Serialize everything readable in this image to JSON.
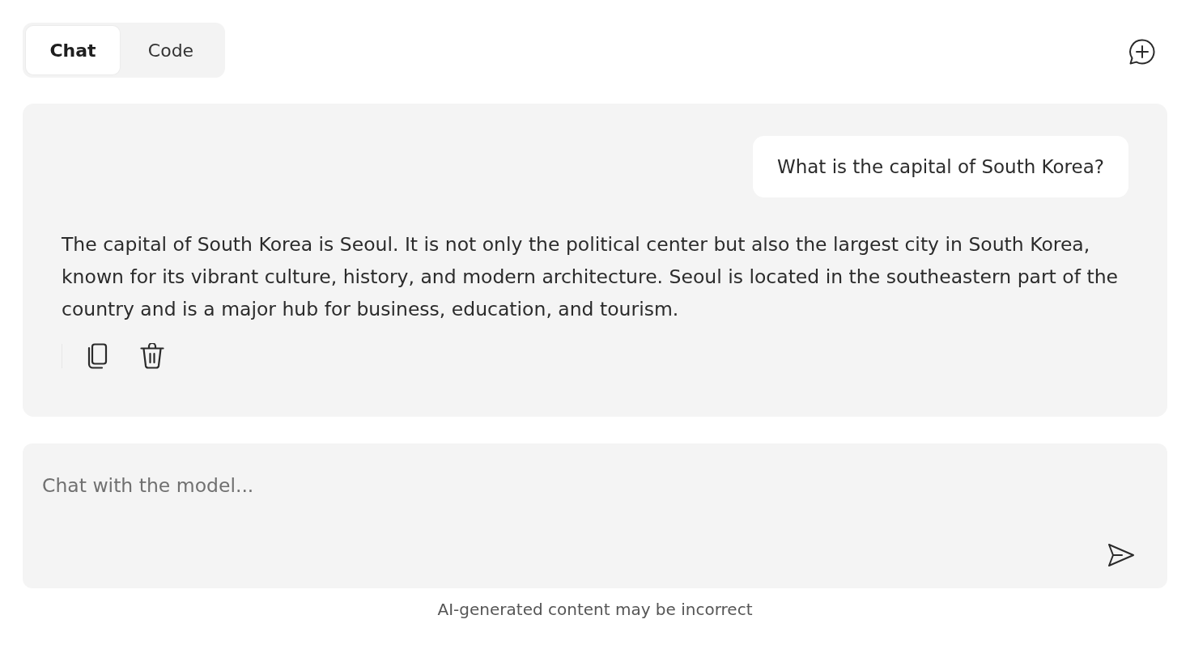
{
  "tabs": [
    {
      "label": "Chat",
      "selected": true
    },
    {
      "label": "Code",
      "selected": false
    }
  ],
  "conversation": {
    "messages": [
      {
        "kind": "user",
        "text": "What is the capital of South Korea?"
      },
      {
        "kind": "assistant",
        "text": "The capital of South Korea is Seoul. It is not only the political center but also the largest city in South Korea, known for its vibrant culture, history, and modern architecture. Seoul is located in the southeastern part of the country and is a major hub for business, education, and tourism."
      }
    ]
  },
  "composer": {
    "placeholder": "Chat with the model..."
  },
  "disclaimer": "AI-generated content may be incorrect"
}
